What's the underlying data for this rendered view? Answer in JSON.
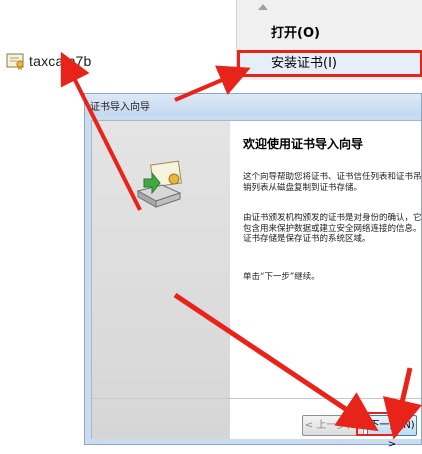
{
  "file": {
    "name": "taxca.p7b"
  },
  "context_menu": {
    "items": [
      {
        "label": "打开(O)"
      },
      {
        "label": "安装证书(I)"
      }
    ]
  },
  "wizard": {
    "title": "证书导入向导",
    "heading": "欢迎使用证书导入向导",
    "paragraph1": "这个向导帮助您将证书、证书信任列表和证书吊销列表从磁盘复制到证书存储。",
    "paragraph2": "由证书颁发机构颁发的证书是对身份的确认，它包含用来保护数据或建立安全网络连接的信息。证书存储是保存证书的系统区域。",
    "paragraph3": "单击“下一步”继续。",
    "back_button": "< 上一步(B)",
    "next_button": "下一步(N) >"
  },
  "colors": {
    "annotation_arrow": "#e8241a",
    "highlight": "#e5eef9"
  },
  "icons": [
    "certificate-file-icon",
    "certificate-import-icon",
    "scroll-up-icon"
  ]
}
